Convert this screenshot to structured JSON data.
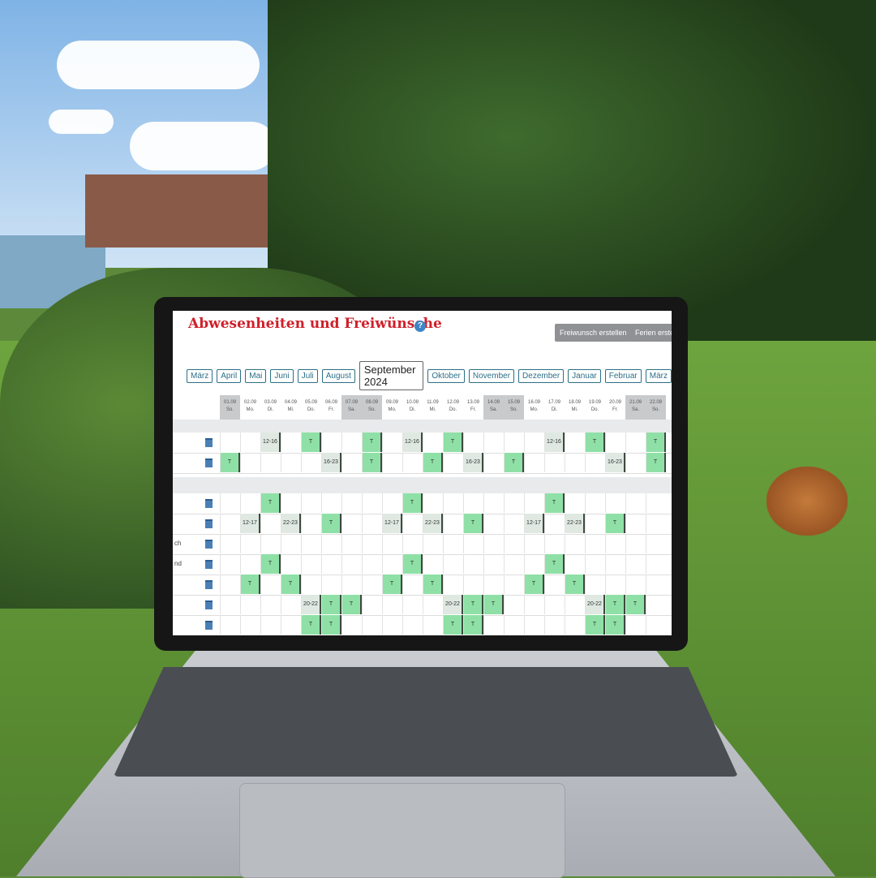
{
  "app": {
    "title": "Abwesenheiten und Freiwünsche",
    "help_icon": "question-circle-icon",
    "buttons": [
      "Freiwunsch erstellen",
      "Ferien erstellen"
    ],
    "months": [
      "März",
      "April",
      "Mai",
      "Juni",
      "Juli",
      "August",
      "September 2024",
      "Oktober",
      "November",
      "Dezember",
      "Januar",
      "Februar",
      "März"
    ],
    "current_month_index": 6,
    "days": [
      {
        "date": "01.09",
        "wd": "So.",
        "weekend": true
      },
      {
        "date": "02.09",
        "wd": "Mo."
      },
      {
        "date": "03.09",
        "wd": "Di."
      },
      {
        "date": "04.09",
        "wd": "Mi."
      },
      {
        "date": "05.09",
        "wd": "Do."
      },
      {
        "date": "06.09",
        "wd": "Fr."
      },
      {
        "date": "07.09",
        "wd": "Sa.",
        "weekend": true
      },
      {
        "date": "08.09",
        "wd": "So.",
        "weekend": true
      },
      {
        "date": "09.09",
        "wd": "Mo."
      },
      {
        "date": "10.09",
        "wd": "Di."
      },
      {
        "date": "11.09",
        "wd": "Mi."
      },
      {
        "date": "12.09",
        "wd": "Do."
      },
      {
        "date": "13.09",
        "wd": "Fr."
      },
      {
        "date": "14.09",
        "wd": "Sa.",
        "weekend": true
      },
      {
        "date": "15.09",
        "wd": "So.",
        "weekend": true
      },
      {
        "date": "16.09",
        "wd": "Mo."
      },
      {
        "date": "17.09",
        "wd": "Di."
      },
      {
        "date": "18.09",
        "wd": "Mi."
      },
      {
        "date": "19.09",
        "wd": "Do."
      },
      {
        "date": "20.09",
        "wd": "Fr."
      },
      {
        "date": "21.09",
        "wd": "Sa.",
        "weekend": true
      },
      {
        "date": "22.09",
        "wd": "So.",
        "weekend": true
      }
    ],
    "groups": [
      {
        "rows": [
          {
            "name": "",
            "cells": [
              "",
              "",
              "12-16",
              "",
              "T",
              "",
              "",
              "T",
              "",
              "12-16",
              "",
              "T",
              "",
              "",
              "",
              "",
              "12-16",
              "",
              "T",
              "",
              "",
              "T"
            ]
          },
          {
            "name": "",
            "cells": [
              "T",
              "",
              "",
              "",
              "",
              "16-23",
              "",
              "T",
              "",
              "",
              "T",
              "",
              "16-23",
              "",
              "T",
              "",
              "",
              "",
              "",
              "16-23",
              "",
              "T"
            ]
          }
        ]
      },
      {
        "rows": [
          {
            "name": "",
            "cells": [
              "",
              "",
              "T",
              "",
              "",
              "",
              "",
              "",
              "",
              "T",
              "",
              "",
              "",
              "",
              "",
              "",
              "T",
              "",
              "",
              "",
              "",
              ""
            ]
          },
          {
            "name": "",
            "cells": [
              "",
              "12-17",
              "",
              "22-23",
              "",
              "T",
              "",
              "",
              "12-17",
              "",
              "22-23",
              "",
              "T",
              "",
              "",
              "12-17",
              "",
              "22-23",
              "",
              "T",
              "",
              ""
            ]
          },
          {
            "name": "ch",
            "cells": [
              "",
              "",
              "",
              "",
              "",
              "",
              "",
              "",
              "",
              "",
              "",
              "",
              "",
              "",
              "",
              "",
              "",
              "",
              "",
              "",
              "",
              ""
            ]
          },
          {
            "name": "nd",
            "cells": [
              "",
              "",
              "T",
              "",
              "",
              "",
              "",
              "",
              "",
              "T",
              "",
              "",
              "",
              "",
              "",
              "",
              "T",
              "",
              "",
              "",
              "",
              ""
            ]
          },
          {
            "name": "",
            "cells": [
              "",
              "T",
              "",
              "T",
              "",
              "",
              "",
              "",
              "T",
              "",
              "T",
              "",
              "",
              "",
              "",
              "T",
              "",
              "T",
              "",
              "",
              "",
              ""
            ]
          },
          {
            "name": "",
            "cells": [
              "",
              "",
              "",
              "",
              "20-22",
              "T",
              "T",
              "",
              "",
              "",
              "",
              "20-22",
              "T",
              "T",
              "",
              "",
              "",
              "",
              "20-22",
              "T",
              "T",
              ""
            ]
          },
          {
            "name": "",
            "cells": [
              "",
              "",
              "",
              "",
              "T",
              "T",
              "",
              "",
              "",
              "",
              "",
              "T",
              "T",
              "",
              "",
              "",
              "",
              "",
              "T",
              "T",
              "",
              ""
            ]
          }
        ]
      }
    ],
    "colors": {
      "title": "#d0202a",
      "accent": "#2c6f86",
      "booked": "#8fe0a6",
      "request": "#dfe9e2",
      "weekend": "#c9cacc"
    },
    "calendar_icon": "calendar-icon"
  }
}
